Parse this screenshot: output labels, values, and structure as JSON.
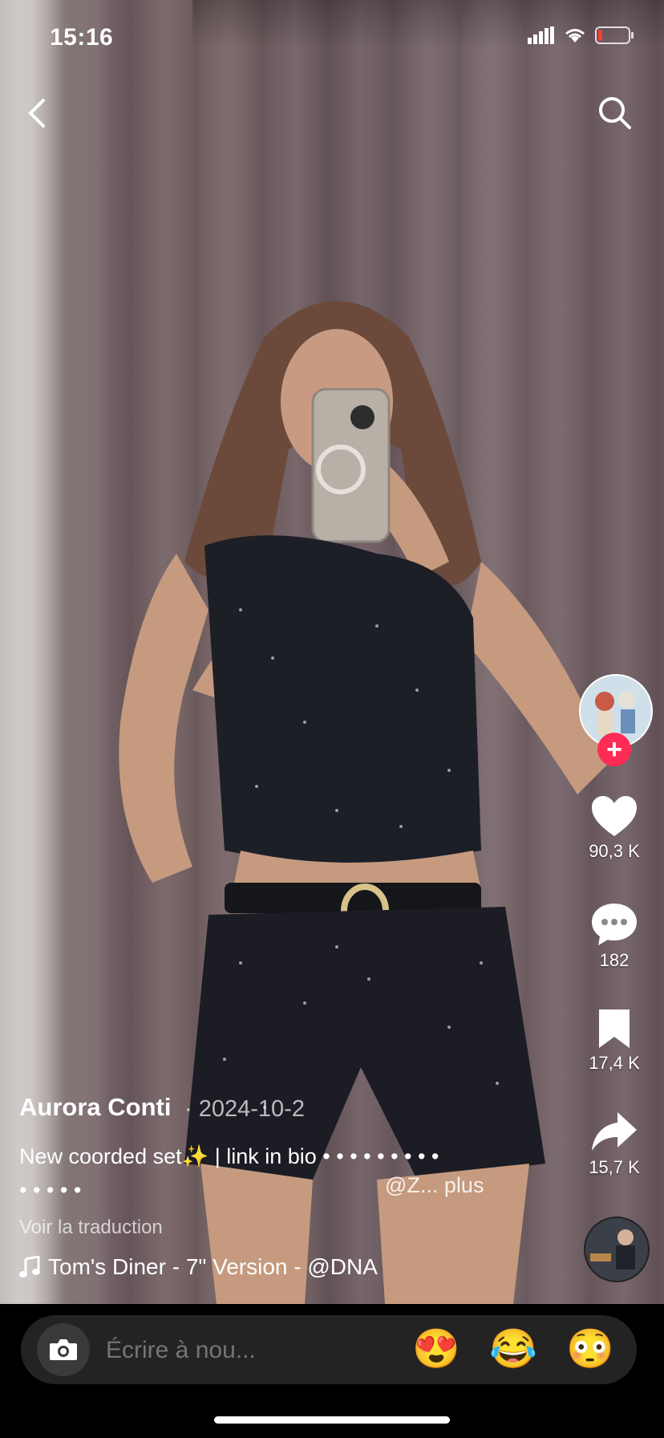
{
  "status_bar": {
    "time": "15:16"
  },
  "video": {
    "author": "Aurora Conti",
    "date_separator": "·",
    "date": "2024-10-2",
    "caption_line1": "New coorded set✨ | link in bio • • • • • • • • •",
    "caption_line2": "• • • • •",
    "caption_more": "@Z... plus",
    "translate": "Voir la traduction",
    "music": "Tom's Diner - 7\" Version - @DNA"
  },
  "actions": {
    "likes": "90,3 K",
    "comments": "182",
    "saves": "17,4 K",
    "shares": "15,7 K"
  },
  "comment_bar": {
    "placeholder": "Écrire à nou...",
    "emojis": [
      "😍",
      "😂",
      "😳"
    ]
  },
  "icons": {
    "back": "chevron-left-icon",
    "search": "search-icon",
    "like": "heart-icon",
    "comment": "comment-bubble-icon",
    "save": "bookmark-icon",
    "share": "share-arrow-icon",
    "music": "music-note-icon",
    "camera": "camera-icon"
  },
  "colors": {
    "follow": "#fe2c55",
    "background": "#000000"
  }
}
